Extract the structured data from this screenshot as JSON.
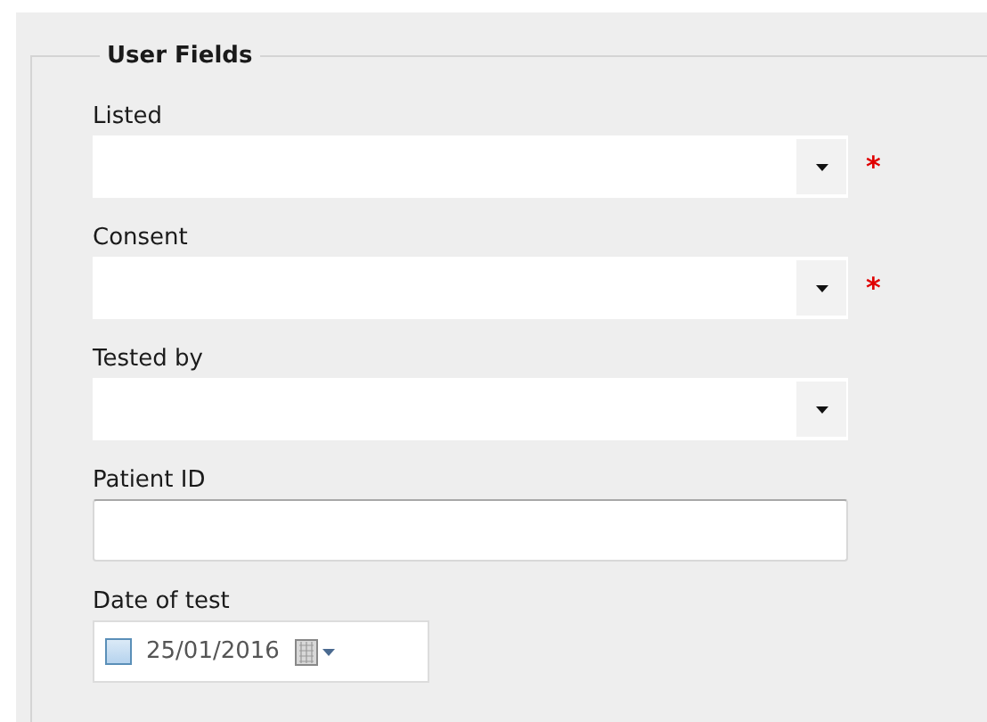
{
  "group": {
    "title": "User Fields"
  },
  "fields": [
    {
      "kind": "combo",
      "label": "Listed",
      "required": true
    },
    {
      "kind": "combo",
      "label": "Consent",
      "required": true
    },
    {
      "kind": "combo",
      "label": "Tested by",
      "required": false
    },
    {
      "kind": "text",
      "label": "Patient ID"
    },
    {
      "kind": "date",
      "label": "Date of test",
      "value": "25/01/2016",
      "checked": false
    }
  ],
  "required_mark": "*"
}
